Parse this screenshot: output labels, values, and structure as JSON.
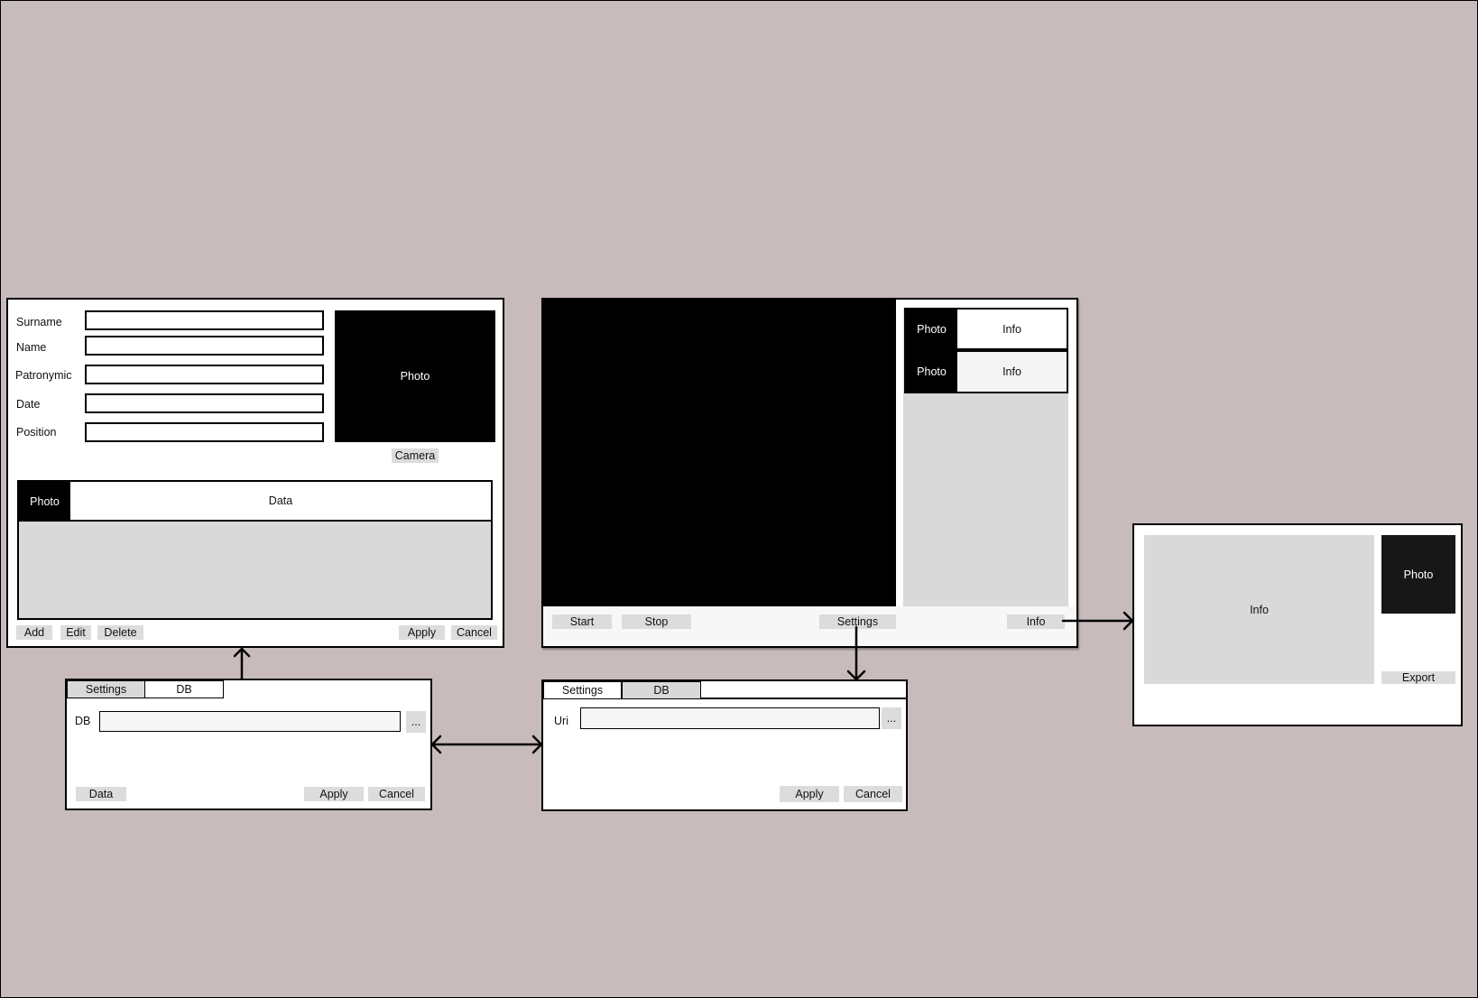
{
  "person_form": {
    "fields": [
      {
        "label": "Surname",
        "value": ""
      },
      {
        "label": "Name",
        "value": ""
      },
      {
        "label": "Patronymic",
        "value": ""
      },
      {
        "label": "Date",
        "value": ""
      },
      {
        "label": "Position",
        "value": ""
      }
    ],
    "photo_label": "Photo",
    "camera_button": "Camera",
    "table": {
      "photo_header": "Photo",
      "data_header": "Data"
    },
    "buttons": {
      "add": "Add",
      "edit": "Edit",
      "delete": "Delete",
      "apply": "Apply",
      "cancel": "Cancel"
    }
  },
  "db_dialog": {
    "tabs": [
      {
        "label": "Settings"
      },
      {
        "label": "DB"
      }
    ],
    "db_label": "DB",
    "db_value": "",
    "browse_button": "...",
    "buttons": {
      "data": "Data",
      "apply": "Apply",
      "cancel": "Cancel"
    }
  },
  "main_window": {
    "list": [
      {
        "photo": "Photo",
        "info": "Info"
      },
      {
        "photo": "Photo",
        "info": "Info"
      }
    ],
    "buttons": {
      "start": "Start",
      "stop": "Stop",
      "settings": "Settings",
      "info": "Info"
    }
  },
  "uri_dialog": {
    "tabs": [
      {
        "label": "Settings"
      },
      {
        "label": "DB"
      }
    ],
    "uri_label": "Uri",
    "uri_value": "",
    "browse_button": "...",
    "buttons": {
      "apply": "Apply",
      "cancel": "Cancel"
    }
  },
  "info_window": {
    "info_label": "Info",
    "photo_label": "Photo",
    "export_button": "Export"
  },
  "colors": {
    "background": "#c8bbbb",
    "panel_gray": "#d9d9d9",
    "button_gray": "#dcdcdc"
  }
}
